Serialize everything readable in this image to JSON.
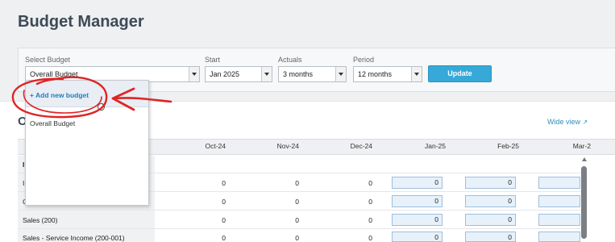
{
  "app": {
    "title": "Budget Manager"
  },
  "filters": {
    "select_budget": {
      "label": "Select Budget",
      "value": "Overall Budget"
    },
    "start": {
      "label": "Start",
      "value": "Jan 2025"
    },
    "actuals": {
      "label": "Actuals",
      "value": "3 months"
    },
    "period": {
      "label": "Period",
      "value": "12 months"
    },
    "update_label": "Update"
  },
  "dropdown": {
    "add_label": "+ Add new budget",
    "items": [
      "Overall Budget"
    ]
  },
  "section": {
    "heading": "O",
    "wide_view_label": "Wide view",
    "wide_view_icon": "↗"
  },
  "table": {
    "columns": [
      "Oct-24",
      "Nov-24",
      "Dec-24",
      "Jan-25",
      "Feb-25",
      "Mar-2"
    ],
    "rows": [
      {
        "label": "I",
        "values": [
          "",
          "",
          "",
          "",
          "",
          ""
        ]
      },
      {
        "label": "I",
        "values": [
          "0",
          "0",
          "0",
          "0",
          "0",
          ""
        ]
      },
      {
        "label": "C",
        "values": [
          "0",
          "0",
          "0",
          "0",
          "0",
          ""
        ]
      },
      {
        "label": "Sales (200)",
        "values": [
          "0",
          "0",
          "0",
          "0",
          "0",
          ""
        ]
      },
      {
        "label": "Sales - Service Income (200-001)",
        "values": [
          "0",
          "0",
          "0",
          "0",
          "0",
          ""
        ]
      }
    ]
  },
  "colors": {
    "accent": "#36a9d8",
    "annotation": "#e02424",
    "link": "#2f8dbd"
  }
}
